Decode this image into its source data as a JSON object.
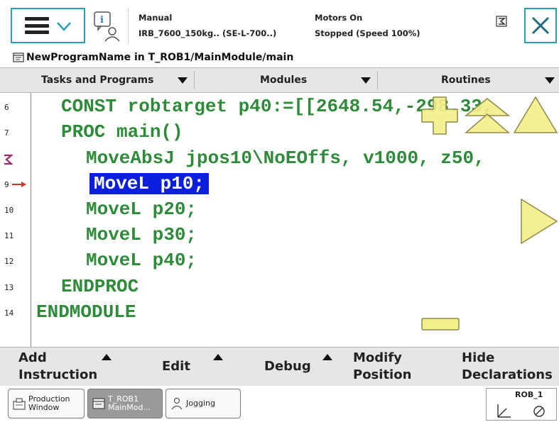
{
  "status": {
    "mode": "Manual",
    "controller": "IRB_7600_150kg.. (SE-L-700..)",
    "motors": "Motors On",
    "execution": "Stopped (Speed 100%)"
  },
  "path": "NewProgramName in T_ROB1/MainModule/main",
  "columns": {
    "tasks": "Tasks and Programs",
    "modules": "Modules",
    "routines": "Routines"
  },
  "code_lines": [
    {
      "num": "6",
      "text": "CONST robtarget p40:=[[2648.54,-298.33,"
    },
    {
      "num": "7",
      "text": "PROC main()"
    },
    {
      "num": "",
      "text": "MoveAbsJ jpos10\\NoEOffs, v1000, z50,"
    },
    {
      "num": "9",
      "text": "MoveL p10;"
    },
    {
      "num": "10",
      "text": "MoveL p20;"
    },
    {
      "num": "11",
      "text": "MoveL p30;"
    },
    {
      "num": "12",
      "text": "MoveL p40;"
    },
    {
      "num": "13",
      "text": "ENDPROC"
    },
    {
      "num": "14",
      "text": "ENDMODULE"
    }
  ],
  "toolbar": {
    "add_instruction": "Add\nInstruction",
    "edit": "Edit",
    "debug": "Debug",
    "modify_position": "Modify\nPosition",
    "hide_declarations": "Hide\nDeclarations"
  },
  "taskbar": {
    "production_window": "Production\nWindow",
    "program_editor": "T_ROB1\nMainMod...",
    "jogging": "Jogging",
    "robot": "ROB_1"
  },
  "colors": {
    "code": "#2e8b3a",
    "selection": "#0b1fdc",
    "accent": "#2a9fb1",
    "nav_controls": "#f3ef8a"
  }
}
